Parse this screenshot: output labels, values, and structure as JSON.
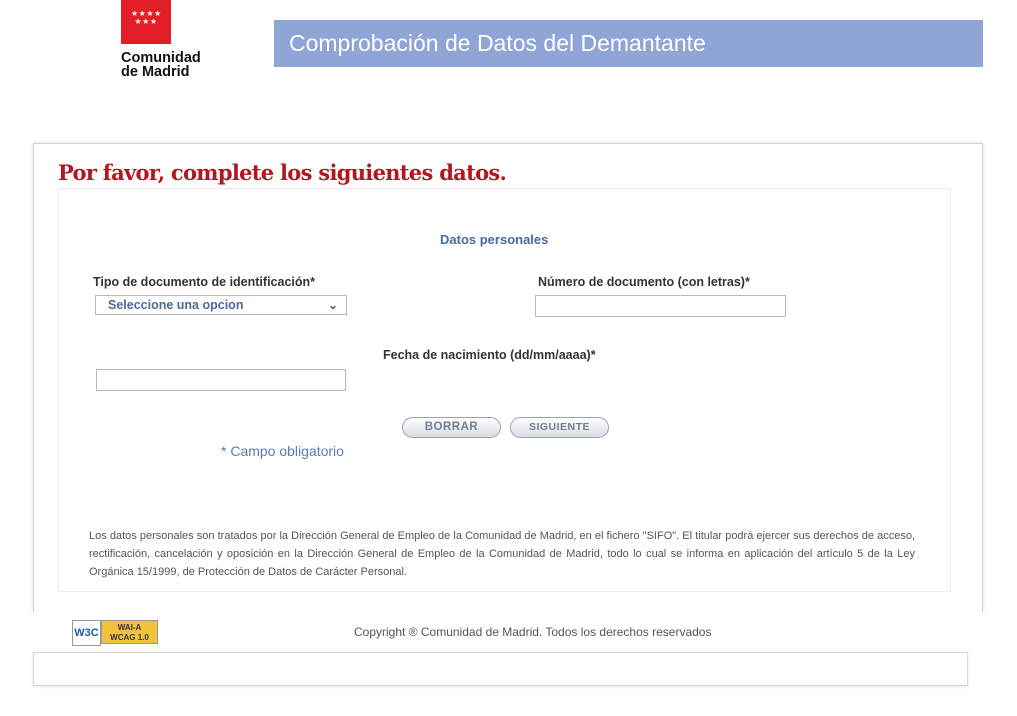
{
  "logo": {
    "stars": "★★★★ ★★★",
    "line1": "Comunidad",
    "line2": "de Madrid"
  },
  "banner": {
    "title": "Comprobación de Datos del Demantante"
  },
  "form": {
    "heading": "Por favor, complete los siguientes datos.",
    "section_title": "Datos personales",
    "doc_type": {
      "label": "Tipo de documento de identificación*",
      "selected": "Seleccione una opcion"
    },
    "doc_number": {
      "label": "Número de documento (con letras)*",
      "value": ""
    },
    "birth_date": {
      "label": "Fecha de nacimiento (dd/mm/aaaa)*",
      "value": ""
    },
    "buttons": {
      "clear": "BORRAR",
      "next": "SIGUIENTE"
    },
    "required_note": "* Campo obligatorio"
  },
  "legal_text": "Los datos personales son tratados por la Dirección General de Empleo de la Comunidad de Madrid, en el fichero \"SIFO\". El titular podrá ejercer sus derechos de acceso, rectificación, cancelación y oposición en la Dirección General de Empleo de la Comunidad de Madrid, todo lo cual se informa en aplicación del artículo 5 de la Ley Orgánica 15/1999, de Protección de Datos de Carácter Personal.",
  "footer": {
    "badge_w3c": "W3C",
    "badge_wai_line1": "WAI-A",
    "badge_wai_line2": "WCAG 1.0",
    "copyright": "Copyright ® Comunidad de Madrid. Todos los derechos reservados"
  },
  "colors": {
    "brand_red": "#e41e26",
    "banner_blue": "#8ea5d6",
    "heading_red": "#b3161f",
    "link_blue": "#4a6a9b"
  }
}
